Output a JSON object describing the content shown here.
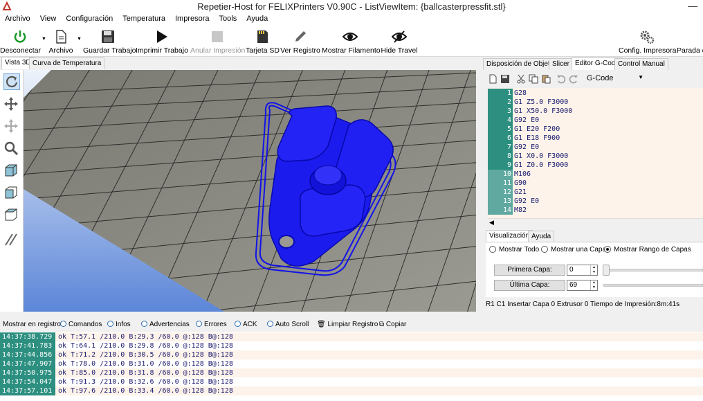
{
  "window": {
    "title": "Repetier-Host for FELIXPrinters V0.90C - ListViewItem: {ballcasterpressfit.stl}"
  },
  "menu": [
    "Archivo",
    "View",
    "Configuración",
    "Temperatura",
    "Impresora",
    "Tools",
    "Ayuda"
  ],
  "toolbar": {
    "disconnect": "Desconectar",
    "file": "Archivo",
    "save_job": "Guardar Trabajo",
    "print_job": "Imprimir Trabajo",
    "cancel_print": "Anular Impresión",
    "sd_card": "Tarjeta SD",
    "show_log": "Ver Registro",
    "show_filament": "Mostrar Filamento",
    "hide_travel": "Hide Travel",
    "printer_config": "Config. Impresora",
    "emergency_stop": "Parada de"
  },
  "view_tabs": [
    "Vista 3D",
    "Curva de Temperatura"
  ],
  "right_tabs": [
    "Disposición de Objetos",
    "Slicer",
    "Editor G-Code",
    "Control Manual"
  ],
  "gcode": {
    "selector": "G-Code",
    "lines": [
      {
        "n": "1",
        "code": "G28"
      },
      {
        "n": "2",
        "code": "G1 Z5.0 F3000"
      },
      {
        "n": "3",
        "code": "G1 X50.0 F3000"
      },
      {
        "n": "4",
        "code": "G92 E0"
      },
      {
        "n": "5",
        "code": "G1 E20 F200"
      },
      {
        "n": "6",
        "code": "G1 E18 F900"
      },
      {
        "n": "7",
        "code": "G92 E0"
      },
      {
        "n": "8",
        "code": "G1 X0.0 F3000"
      },
      {
        "n": "9",
        "code": "G1 Z0.0 F3000"
      },
      {
        "n": "10",
        "code": "M106"
      },
      {
        "n": "11",
        "code": "G90"
      },
      {
        "n": "12",
        "code": "G21"
      },
      {
        "n": "13",
        "code": "G92 E0"
      },
      {
        "n": "14",
        "code": "M82"
      }
    ]
  },
  "vis_tabs": [
    "Visualización",
    "Ayuda"
  ],
  "visualization": {
    "show_all": "Mostrar Todo",
    "show_one": "Mostrar una Capa",
    "show_range": "Mostrar Rango de Capas",
    "first_layer_label": "Primera Capa:",
    "first_layer_value": "0",
    "last_layer_label": "Última Capa:",
    "last_layer_value": "69"
  },
  "status": "R1   C1   Insertar   Capa 0   Extrusor 0   Tiempo de Impresión:8m:41s",
  "logbar": {
    "label": "Mostrar en registro:",
    "commands": "Comandos",
    "infos": "Infos",
    "warnings": "Advertencias",
    "errors": "Errores",
    "ack": "ACK",
    "autoscroll": "Auto Scroll",
    "clear": "Limpiar Registro",
    "copy": "Copiar"
  },
  "log": [
    {
      "time": "14:37:38.729",
      "msg": "ok T:57.1 /210.0 B:29.3 /60.0 @:128 B@:128"
    },
    {
      "time": "14:37:41.783",
      "msg": "ok T:64.1 /210.0 B:29.8 /60.0 @:128 B@:128"
    },
    {
      "time": "14:37:44.856",
      "msg": "ok T:71.2 /210.0 B:30.5 /60.0 @:128 B@:128"
    },
    {
      "time": "14:37:47.907",
      "msg": "ok T:78.0 /210.0 B:31.0 /60.0 @:128 B@:128"
    },
    {
      "time": "14:37:50.975",
      "msg": "ok T:85.0 /210.0 B:31.8 /60.0 @:128 B@:128"
    },
    {
      "time": "14:37:54.047",
      "msg": "ok T:91.3 /210.0 B:32.6 /60.0 @:128 B@:128"
    },
    {
      "time": "14:37:57.101",
      "msg": "ok T:97.6 /210.0 B:33.4 /60.0 @:128 B@:128"
    }
  ],
  "colors": {
    "model": "#1212e8",
    "gcode_gutter": "#2c8f80",
    "gcode_bg": "#fdf3ea"
  }
}
